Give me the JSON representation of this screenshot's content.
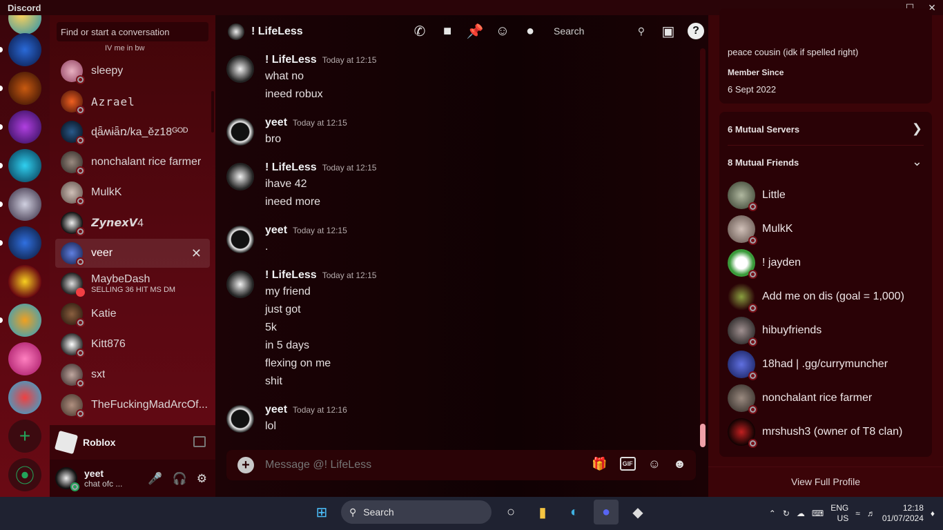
{
  "app": {
    "title": "Discord"
  },
  "sidebar": {
    "find_placeholder": "Find or start a conversation",
    "partial_top": "IV me in bw",
    "dms": [
      {
        "name": "sleepy"
      },
      {
        "name": "Azrael"
      },
      {
        "name": "ɖǟʍɨǟռ/ka_ěz18ᴳᴼᴰ"
      },
      {
        "name": "nonchalant rice farmer"
      },
      {
        "name": "MulkK"
      },
      {
        "name": "𝙕𝙮𝙣𝙚𝙭𝙑4"
      },
      {
        "name": "veer",
        "selected": true
      },
      {
        "name": "MaybeDash",
        "sub": "SELLING 36 HIT MS DM"
      },
      {
        "name": "Katie"
      },
      {
        "name": "Kitt876"
      },
      {
        "name": "sxt"
      },
      {
        "name": "TheFuckingMadArcOf..."
      }
    ],
    "activity": {
      "name": "Roblox"
    },
    "user": {
      "name": "yeet",
      "status": "chat ofc ..."
    }
  },
  "chat": {
    "header_name": "! LifeLess",
    "search_label": "Search",
    "composer_placeholder": "Message @! LifeLess",
    "gif_label": "GIF",
    "messages": [
      {
        "author": "! LifeLess",
        "time": "Today at 12:15",
        "lines": [
          "what no",
          "ineed robux"
        ]
      },
      {
        "author": "yeet",
        "time": "Today at 12:15",
        "lines": [
          "bro"
        ]
      },
      {
        "author": "! LifeLess",
        "time": "Today at 12:15",
        "lines": [
          "ihave 42",
          "ineed more"
        ]
      },
      {
        "author": "yeet",
        "time": "Today at 12:15",
        "lines": [
          "."
        ]
      },
      {
        "author": "! LifeLess",
        "time": "Today at 12:15",
        "lines": [
          "my friend",
          "just got",
          "5k",
          "in 5 days",
          "flexing on me",
          "shit"
        ]
      },
      {
        "author": "yeet",
        "time": "Today at 12:16",
        "lines": [
          "lol"
        ]
      }
    ]
  },
  "profile": {
    "bio_partial": "peace cousin (idk if spelled right)",
    "member_since_label": "Member Since",
    "member_since": "6 Sept 2022",
    "mutual_servers": "6 Mutual Servers",
    "mutual_friends": "8 Mutual Friends",
    "friends": [
      {
        "name": "Little"
      },
      {
        "name": "MulkK"
      },
      {
        "name": "! jayden"
      },
      {
        "name": "Add me on dis (goal = 1,000)"
      },
      {
        "name": "hibuyfriends"
      },
      {
        "name": "18had | .gg/currymuncher"
      },
      {
        "name": "nonchalant rice farmer"
      },
      {
        "name": "mrshush3 (owner of T8 clan)"
      }
    ],
    "view_full": "View Full Profile"
  },
  "taskbar": {
    "search": "Search",
    "lang": "ENG",
    "region": "US",
    "time": "12:18",
    "date": "01/07/2024"
  },
  "colors": {
    "online": "#23a55a",
    "dnd": "#f23f43",
    "accent": "#5865f2"
  }
}
